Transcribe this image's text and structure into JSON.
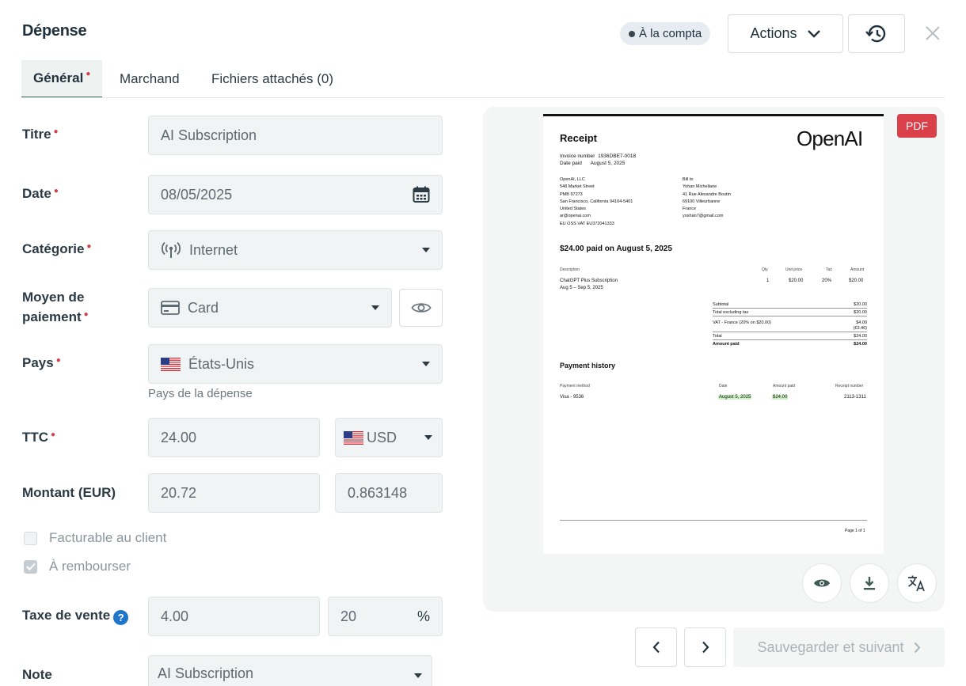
{
  "header": {
    "title": "Dépense",
    "status": "À la compta",
    "actions_label": "Actions"
  },
  "tabs": [
    {
      "label": "Général",
      "required": "●"
    },
    {
      "label": "Marchand"
    },
    {
      "label": "Fichiers attachés (0)"
    }
  ],
  "form": {
    "required_mark": "●",
    "titre": {
      "label": "Titre",
      "value": "AI Subscription"
    },
    "date": {
      "label": "Date",
      "value": "08/05/2025"
    },
    "categorie": {
      "label": "Catégorie",
      "value": "Internet",
      "icon": "antenna-icon"
    },
    "moyen": {
      "label_line1": "Moyen de",
      "label_line2": "paiement",
      "value": "Card",
      "icon": "credit-card-icon"
    },
    "pays": {
      "label": "Pays",
      "value": "États-Unis",
      "helper": "Pays de la dépense"
    },
    "ttc": {
      "label": "TTC",
      "value": "24.00",
      "currency": "USD"
    },
    "montant": {
      "label": "Montant (EUR)",
      "value": "20.72",
      "rate": "0.863148"
    },
    "facturable": {
      "label": "Facturable au client",
      "checked": false
    },
    "rembourser": {
      "label": "À rembourser",
      "checked": true
    },
    "taxe": {
      "label": "Taxe de vente",
      "help": "?",
      "value": "4.00",
      "rate": "20",
      "unit": "%"
    },
    "note": {
      "label": "Note",
      "value": "AI Subscription"
    }
  },
  "preview": {
    "badge": "PDF",
    "receipt": {
      "title": "Receipt",
      "brand": "OpenAI",
      "invoice_label": "Invoice number",
      "invoice_number": "1936DBE7-0018",
      "date_paid_label": "Date paid",
      "date_paid": "August 5, 2025",
      "from": [
        "OpenAI, LLC",
        "548 Market Street",
        "PMB 97273",
        "San Francisco, California 94104-5401",
        "United States",
        "ar@openai.com",
        "EU OSS VAT EU372041333"
      ],
      "bill_to": [
        "Bill to",
        "Yohan Michellane",
        "41 Rue Alexandre Boutin",
        "69100 Villeurbanne",
        "France",
        "yoshan7@gmail.com"
      ],
      "paid_heading": "$24.00 paid on August 5, 2025",
      "cols": [
        "Description",
        "Qty",
        "Unit price",
        "Tax",
        "Amount"
      ],
      "item": {
        "desc": "ChatGPT Plus Subscription",
        "period": "Aug 5 – Sep 5, 2025",
        "qty": "1",
        "unit": "$20.00",
        "tax": "20%",
        "amount": "$20.00"
      },
      "totals": [
        {
          "label": "Subtotal",
          "value": "$20.00"
        },
        {
          "label": "Total excluding tax",
          "value": "$20.00"
        },
        {
          "label": "VAT - France (20% on $20.00)",
          "value": "$4.00"
        },
        {
          "label": "",
          "value": "(€3.46)"
        },
        {
          "label": "Total",
          "value": "$24.00"
        },
        {
          "label": "Amount paid",
          "value": "$24.00"
        }
      ],
      "history_heading": "Payment history",
      "history_cols": [
        "Payment method",
        "Date",
        "Amount paid",
        "Receipt number"
      ],
      "history_row": {
        "method": "Visa - 9536",
        "date": "August 5, 2025",
        "amount": "$24.00",
        "receipt": "2113-1311"
      },
      "footer": "Page 1 of 1"
    }
  },
  "footer": {
    "save_next": "Sauvegarder et suivant"
  },
  "colors": {
    "required": "#d33f49",
    "tab_active": "#eef2f0",
    "pdf": "#d9404a",
    "help": "#1f75c9"
  }
}
